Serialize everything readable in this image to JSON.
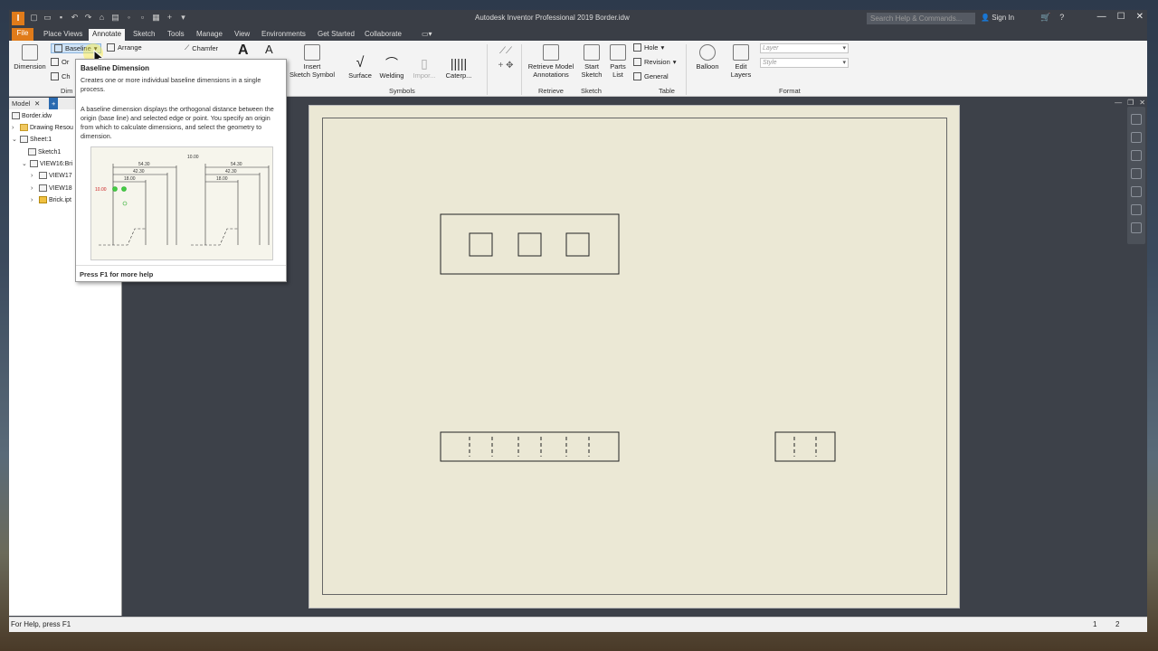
{
  "window": {
    "app_title": "Autodesk Inventor Professional 2019    Border.idw",
    "logo_letter": "I",
    "search_placeholder": "Search Help & Commands...",
    "sign_in": "Sign In"
  },
  "tabs": [
    "File",
    "Place Views",
    "Annotate",
    "Sketch",
    "Tools",
    "Manage",
    "View",
    "Environments",
    "Get Started",
    "Collaborate"
  ],
  "active_tab": "Annotate",
  "ribbon": {
    "dimension": "Dimension",
    "baseline": "Baseline",
    "arrange": "Arrange",
    "chamfer": "Chamfer",
    "ordinate_short": "Or",
    "chain_short": "Ch",
    "dim_panel_short": "Dim",
    "insert_sketch_symbol_1": "Insert",
    "insert_sketch_symbol_2": "Sketch Symbol",
    "surface": "Surface",
    "welding": "Welding",
    "import": "Impor...",
    "caterpillar": "Caterp...",
    "symbols_panel": "Symbols",
    "retrieve_1": "Retrieve Model",
    "retrieve_2": "Annotations",
    "retrieve_panel": "Retrieve",
    "start_sketch_1": "Start",
    "start_sketch_2": "Sketch",
    "sketch_panel": "Sketch",
    "parts_list_1": "Parts",
    "parts_list_2": "List",
    "hole": "Hole",
    "revision": "Revision",
    "general": "General",
    "table_panel": "Table",
    "balloon": "Balloon",
    "edit_layers_1": "Edit",
    "edit_layers_2": "Layers",
    "layer_placeholder": "Layer",
    "style_placeholder": "Style",
    "format_panel": "Format"
  },
  "browser": {
    "tab_model": "Model",
    "items": [
      {
        "label": "Border.idw"
      },
      {
        "label": "Drawing Resou"
      },
      {
        "label": "Sheet:1"
      },
      {
        "label": "Sketch1"
      },
      {
        "label": "VIEW16:Bri"
      },
      {
        "label": "VIEW17"
      },
      {
        "label": "VIEW18"
      },
      {
        "label": "Brick.ipt"
      }
    ]
  },
  "tooltip": {
    "title": "Baseline Dimension",
    "description": "Creates one or more individual baseline dimensions in a single process.",
    "long_description": "A baseline dimension displays the orthogonal distance between the origin (base line) and selected edge or point. You specify an origin from which to calculate dimensions, and select the geometry to dimension.",
    "help": "Press F1 for more help",
    "sample_dims": [
      "54.30",
      "42.30",
      "18.00",
      "10.00"
    ]
  },
  "status": {
    "text": "For Help, press F1",
    "num1": "1",
    "num2": "2"
  },
  "colors": {
    "file_tab": "#e07b1a",
    "sheet": "#ebe8d5",
    "chrome": "#3a3e46"
  }
}
